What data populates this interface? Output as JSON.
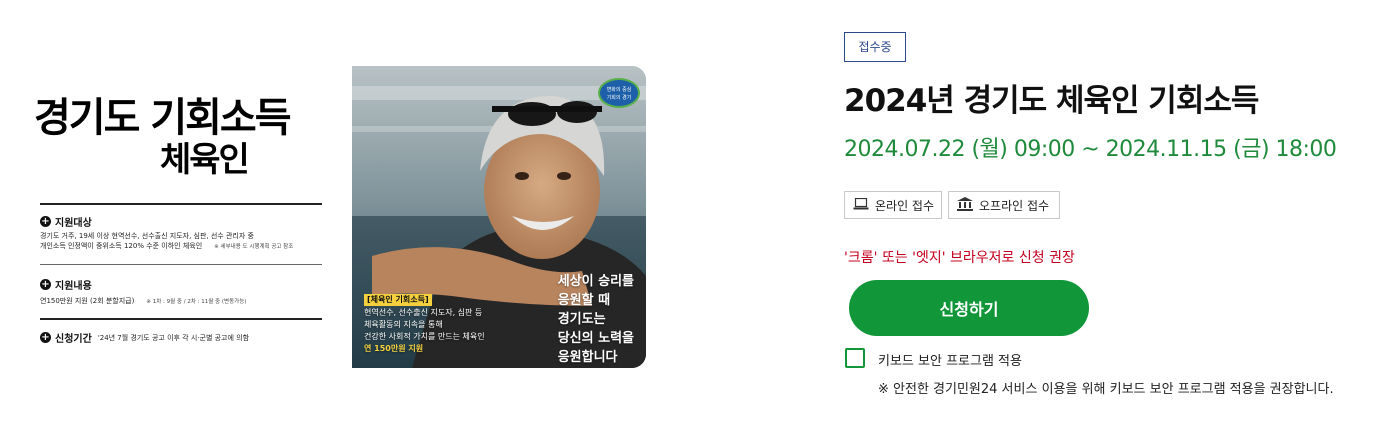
{
  "poster": {
    "title": "경기도 기회소득",
    "subtitle": "체육인",
    "sections": [
      {
        "heading": "지원대상",
        "lines": [
          "경기도 거주, 19세 이상 현역선수, 선수출신 지도자, 심판, 선수 관리자 중",
          "개인소득 인정액이 중위소득 120% 수준 이하인 체육인"
        ],
        "note": "※ 세부내용 도 시행계획 공고 참조"
      },
      {
        "heading": "지원내용",
        "lines": [
          "연150만원 지원 (2회 분할지급)"
        ],
        "note": "※ 1차 : 9월 중 / 2차 : 11월 중 (변동가능)"
      },
      {
        "heading": "신청기간",
        "lines": [
          "'24년 7월 경기도 공고 이후 각 시·군별 공고에 의함"
        ],
        "note": ""
      }
    ]
  },
  "photo": {
    "badge_lines": [
      "변화의 중심",
      "기회의 경기"
    ],
    "slogan": [
      "세상이 승리를",
      "응원할 때",
      "경기도는",
      "당신의 노력을",
      "응원합니다"
    ],
    "info_tag": "[체육인 기회소득]",
    "info_lines": [
      "현역선수, 선수출신 지도자, 심판 등",
      "체육활동의 지속을 통해",
      "건강한 사회적 가치를 만드는 체육인"
    ],
    "info_amount": "연 150만원 지원"
  },
  "status_badge": "접수중",
  "page_title": "2024년 경기도 체육인 기회소득",
  "date_range": "2024.07.22 (월) 09:00 ~ 2024.11.15 (금) 18:00",
  "methods": {
    "online": {
      "label": "온라인 접수",
      "icon": "laptop-icon"
    },
    "offline": {
      "label": "오프라인 접수",
      "icon": "bank-building-icon"
    }
  },
  "browser_notice": "'크롬' 또는 '엣지' 브라우저로 신청 권장",
  "apply_button": "신청하기",
  "keyboard_security": {
    "label": "키보드 보안 프로그램 적용",
    "checked": false,
    "note": "※ 안전한 경기민원24 서비스 이용을 위해 키보드 보안 프로그램 적용을 권장합니다."
  },
  "colors": {
    "green": "#11963a",
    "date_green": "#1f8a3b",
    "notice_red": "#c4001e",
    "badge_navy": "#2d4a8a"
  }
}
